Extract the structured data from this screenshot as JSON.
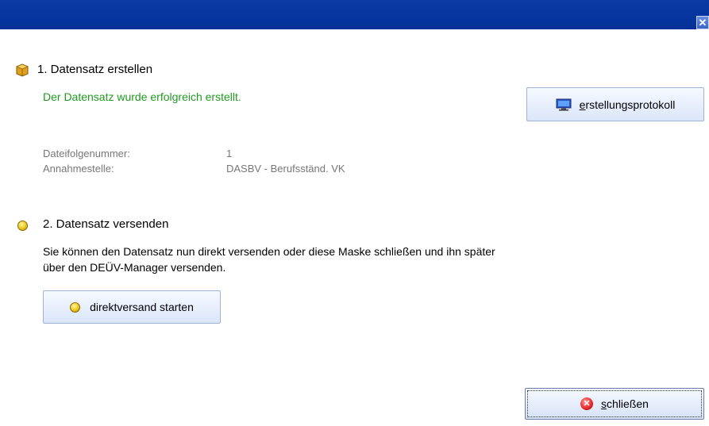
{
  "window": {
    "close_glyph": "✕"
  },
  "step1": {
    "title": "1. Datensatz erstellen",
    "status": "Der Datensatz wurde erfolgreich erstellt.",
    "icon": "package-icon",
    "protocol_button": {
      "label_first": "e",
      "label_rest": "rstellungsprotokoll",
      "icon": "monitor-icon"
    },
    "details": [
      {
        "label": "Dateifolgenummer:",
        "value": "1"
      },
      {
        "label": "Annahmestelle:",
        "value": "DASBV - Berufsständ. VK"
      }
    ]
  },
  "step2": {
    "title": "2. Datensatz versenden",
    "info": "Sie können den Datensatz nun direkt versenden oder diese Maske schließen und ihn später über den DEÜV-Manager versenden.",
    "direct_button": {
      "label": "direktversand starten",
      "icon": "yellow-dot-icon"
    }
  },
  "footer": {
    "close_button": {
      "label_first": "s",
      "label_rest": "chließen",
      "icon": "close-circle-icon"
    }
  },
  "colors": {
    "titlebar": "#05309a",
    "success_text": "#1f9a1f",
    "muted_text": "#777777",
    "status_dot": "#f1d12b"
  }
}
